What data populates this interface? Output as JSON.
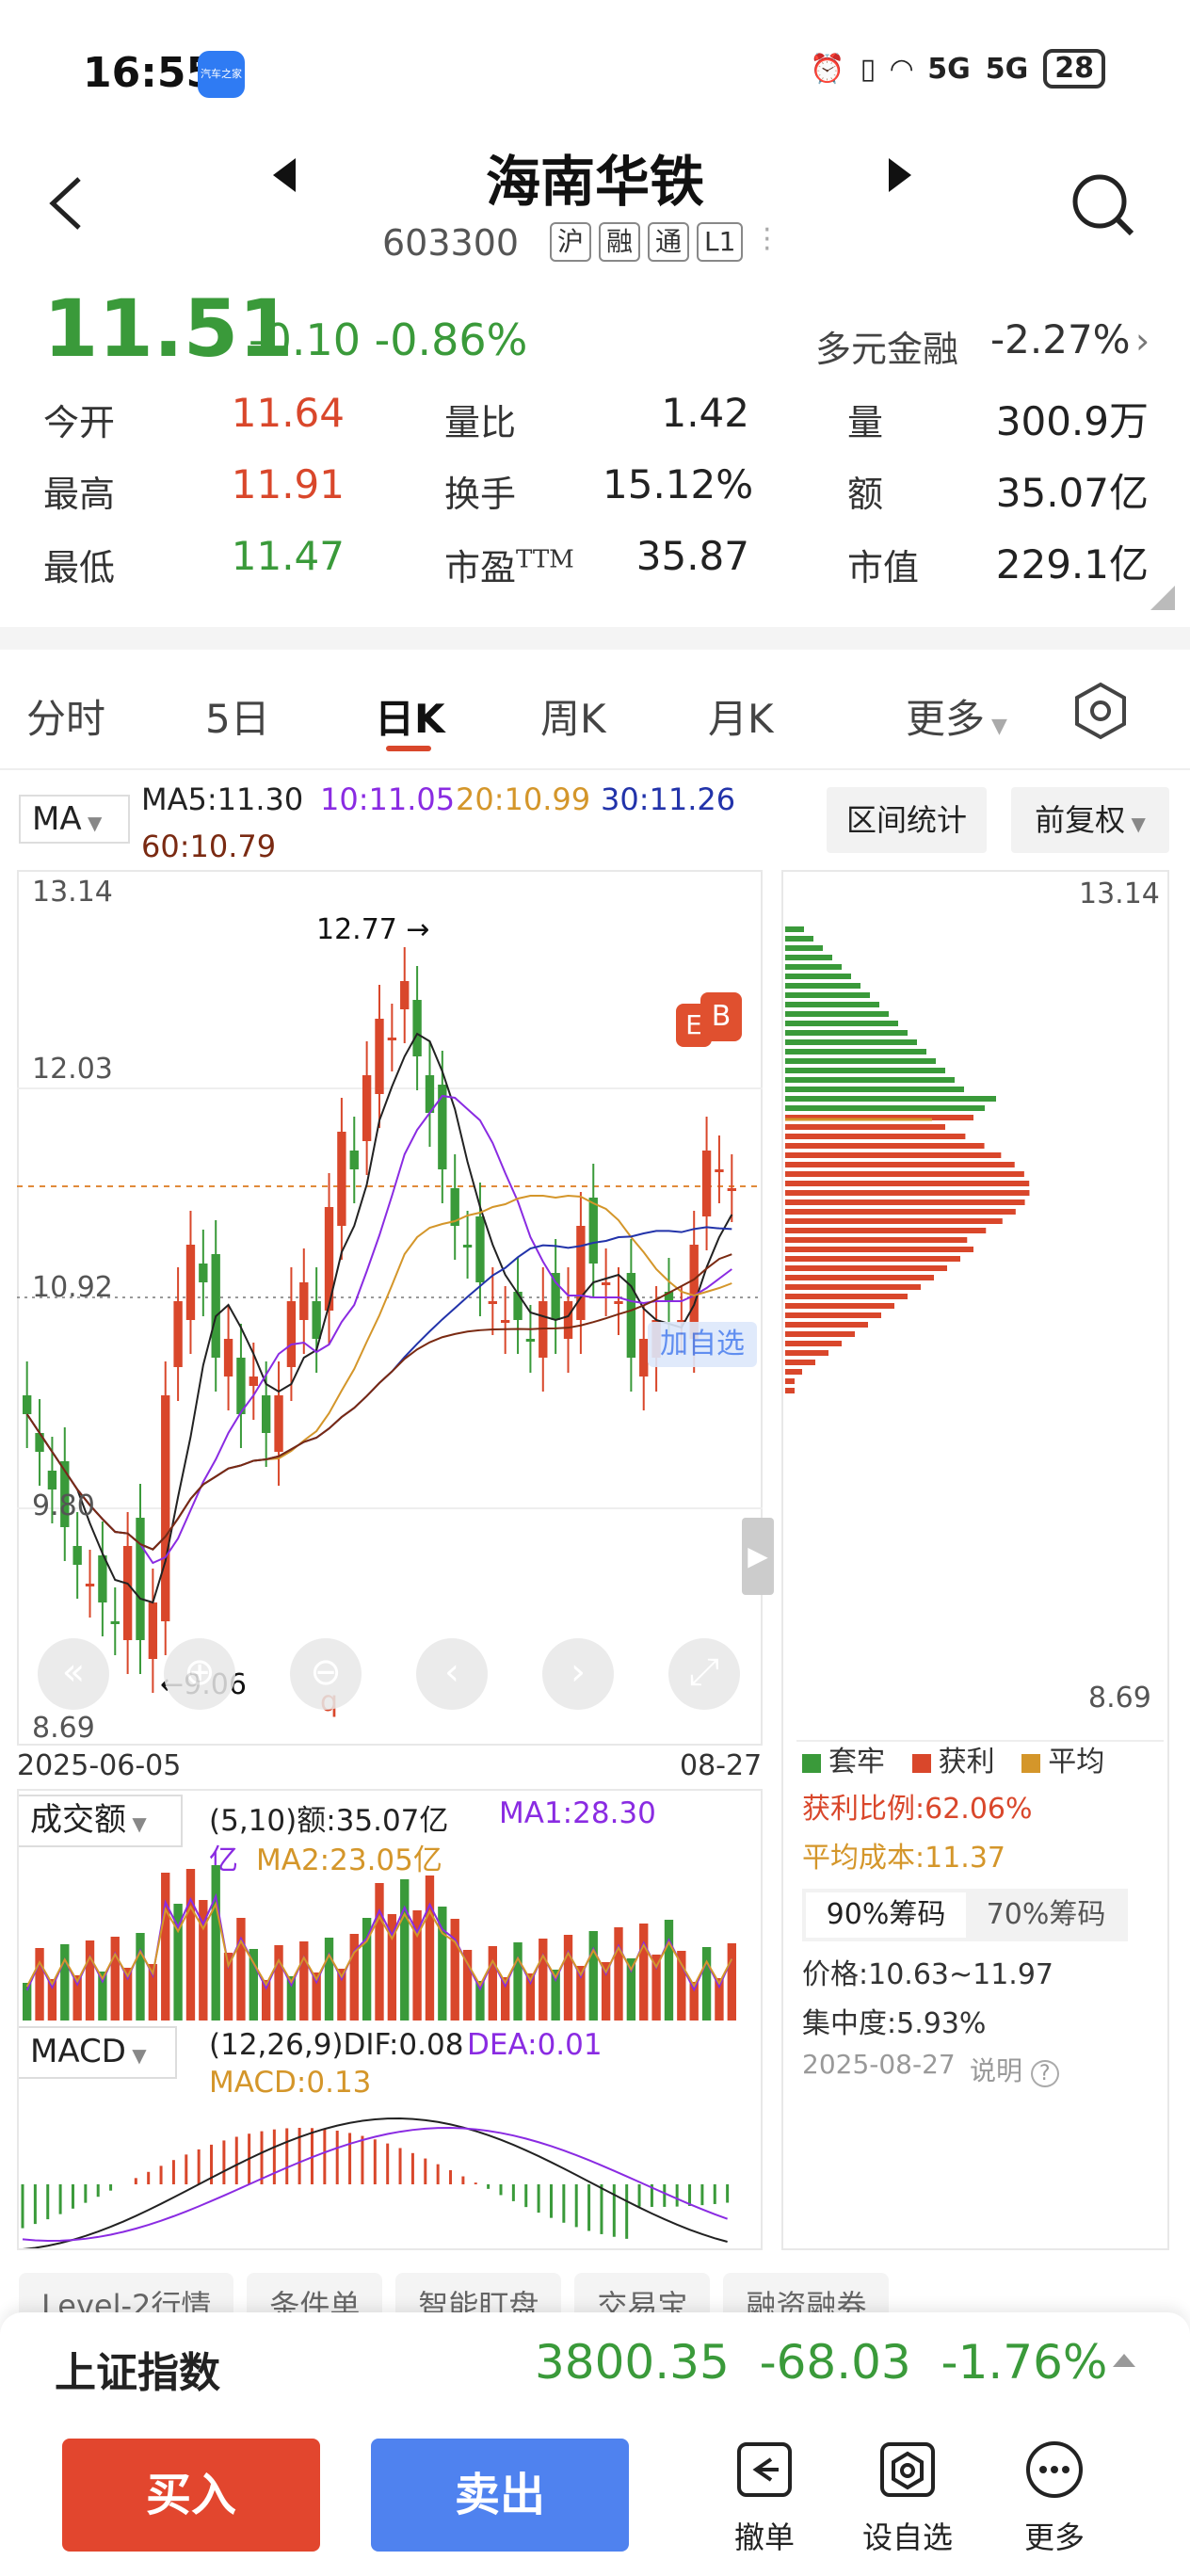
{
  "status": {
    "time": "16:55",
    "app_badge": "汽车之家",
    "signal1": "5G",
    "signal2": "5G",
    "battery": "28"
  },
  "header": {
    "title": "海南华铁",
    "code": "603300",
    "tags": [
      "沪",
      "融",
      "通",
      "L1"
    ]
  },
  "quote": {
    "price": "11.51",
    "change": "-0.10",
    "change_pct": "-0.86%",
    "sector_name": "多元金融",
    "sector_change": "-2.27%",
    "rows": [
      {
        "l1": "今开",
        "v1": "11.64",
        "l2": "量比",
        "v2": "1.42",
        "l3": "量",
        "v3": "300.9万"
      },
      {
        "l1": "最高",
        "v1": "11.91",
        "l2": "换手",
        "v2": "15.12%",
        "l3": "额",
        "v3": "35.07亿"
      },
      {
        "l1": "最低",
        "v1": "11.47",
        "l2": "市盈",
        "l2_sup": "TTM",
        "v2": "35.87",
        "l3": "市值",
        "v3": "229.1亿"
      }
    ]
  },
  "tabs": [
    "分时",
    "5日",
    "日K",
    "周K",
    "月K",
    "更多"
  ],
  "ma_legend": {
    "selector": "MA",
    "ma5": "MA5:11.30",
    "ma10": "10:11.05",
    "ma20": "20:10.99",
    "ma30": "30:11.26",
    "ma60": "60:10.79",
    "range_stats": "区间统计",
    "adjust": "前复权"
  },
  "kchart": {
    "y_labels": [
      "13.14",
      "12.03",
      "10.92",
      "9.80",
      "8.69"
    ],
    "high_label": "12.77",
    "low_label": "9.06",
    "date_start": "2025-06-05",
    "date_end": "08-27",
    "add_watch": "加自选",
    "marker_e": "E",
    "marker_b": "B",
    "marker_q": "q"
  },
  "chips": {
    "top": "13.14",
    "bottom": "8.69",
    "legend": [
      "套牢",
      "获利",
      "平均"
    ],
    "profit_ratio": "获利比例:62.06%",
    "avg_cost": "平均成本:11.37",
    "tab90": "90%筹码",
    "tab70": "70%筹码",
    "price_range": "价格:10.63~11.97",
    "concentration": "集中度:5.93%",
    "date": "2025-08-27",
    "explain": "说明"
  },
  "volume": {
    "selector": "成交额",
    "label": "(5,10)额:35.07亿",
    "ma1": "MA1:28.30",
    "unit": "亿",
    "ma2": "MA2:23.05亿"
  },
  "macd": {
    "selector": "MACD",
    "label": "(12,26,9)DIF:0.08",
    "dea": "DEA:0.01",
    "macd": "MACD:0.13"
  },
  "scroller": [
    "Level-2行情",
    "条件单",
    "智能盯盘",
    "交易宝",
    "融资融券"
  ],
  "index_bar": {
    "name": "上证指数",
    "value": "3800.35",
    "change": "-68.03",
    "pct": "-1.76%"
  },
  "actions": {
    "buy": "买入",
    "sell": "卖出",
    "cancel": "撤单",
    "watch": "设自选",
    "more": "更多"
  },
  "colors": {
    "up": "#d9472b",
    "down": "#3a9a3a",
    "ma5": "#222222",
    "ma10": "#8a2be2",
    "ma20": "#d4962a",
    "ma30": "#2233aa",
    "ma60": "#7a2a12"
  }
}
